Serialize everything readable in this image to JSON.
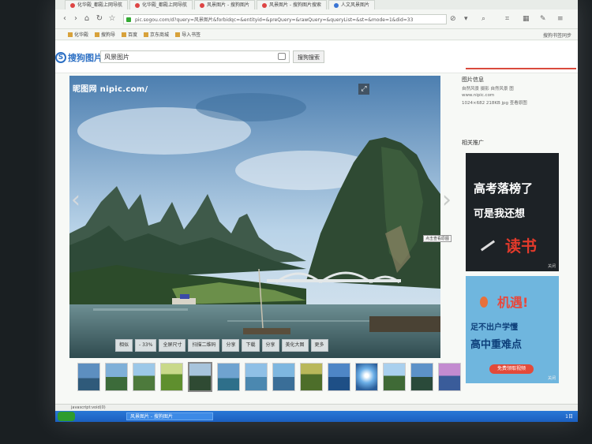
{
  "tabs": [
    {
      "label": "化华殿_都殿上网导航"
    },
    {
      "label": "化华殿_都殿上网导航"
    },
    {
      "label": "风景图片 - 搜狗图片"
    },
    {
      "label": "风景图片 - 搜狗图片搜索"
    },
    {
      "label": "人文风景图片"
    }
  ],
  "address_bar": {
    "url": "pic.sogou.com/d?query=风景图片&forbidqc=&entityid=&preQuery=&rawQuery=&queryList=&st=&mode=1&did=33",
    "ad_filter_label": "⊘"
  },
  "bookmarks": {
    "items": [
      "化华殿",
      "搜狗导",
      "百度",
      "京东商城",
      "导入书签"
    ],
    "right_label": "搜狗书签同步"
  },
  "search": {
    "logo_text": "搜狗图片",
    "query": "风景图片",
    "button_label": "搜狗搜索"
  },
  "viewer": {
    "watermark": "昵图网 nipic.com/",
    "tooltip": "点击查看原图",
    "buttons": [
      "相似",
      "- 33%",
      "全屏尺寸",
      "扫描二维码",
      "分享",
      "下载",
      "分享",
      "美化大图",
      "更多"
    ]
  },
  "sidebar": {
    "info_title": "图片信息",
    "info_line1": "自然风景 摄影 自然风景 图",
    "info_line2": "www.nipic.com",
    "info_line3": "1024×682  218KB  jpg  查看原图",
    "promo_title": "相关推广",
    "ad1": {
      "line1": "高考落榜了",
      "line2": "可是我还想",
      "line3": "读书",
      "close": "关闭"
    },
    "ad2": {
      "line1": "机遇!",
      "line2": "足不出户学懂",
      "line3": "高中重难点",
      "button": "免费领取视频",
      "close": "关闭"
    }
  },
  "status": {
    "text": "javascript:void(0)"
  },
  "taskbar": {
    "task_label": "风景图片 - 搜狗图片",
    "clock": "1日"
  },
  "colors": {
    "accent_red": "#d94a3d",
    "brand_blue": "#2c6fc4",
    "taskbar": "#1b5fc0"
  }
}
